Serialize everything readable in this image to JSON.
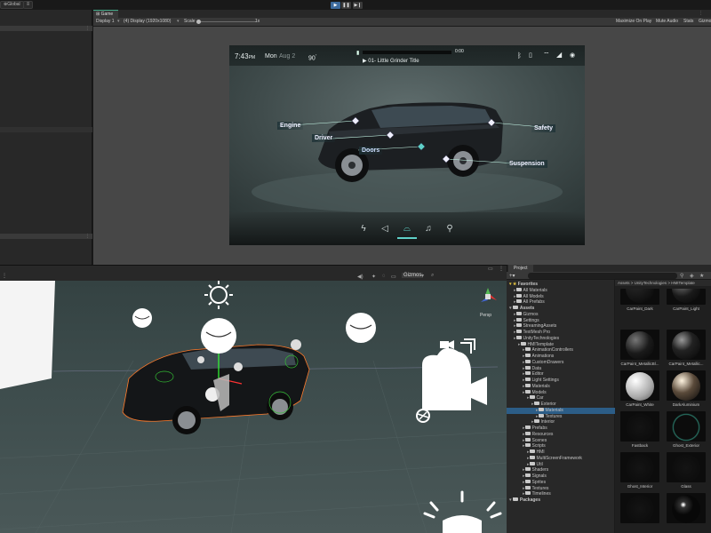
{
  "toolbar": {
    "global_label": "Global",
    "play_icon": "play-icon",
    "pause_icon": "pause-icon",
    "step_icon": "step-icon"
  },
  "game": {
    "tab_label": "Game",
    "display": "Display 1",
    "resolution": "(4) Display (1920x1080)",
    "scale_label": "Scale",
    "scale_value": "1x",
    "maximize": "Maximize On Play",
    "mute": "Mute Audio",
    "stats": "Stats",
    "gizmos": "Gizmos"
  },
  "hmi": {
    "time": "7:43",
    "time_suffix": "PM",
    "day": "Mon",
    "date": "Aug 2",
    "temp": "90",
    "track_time": "0:00",
    "track_title": "01- Little Grinder Title",
    "labels": {
      "engine": "Engine",
      "driver": "Driver",
      "doors": "Doors",
      "safety": "Safety",
      "suspension": "Suspension"
    },
    "dock_icons": [
      "bolt-icon",
      "navigation-icon",
      "car-icon",
      "music-icon",
      "user-icon"
    ]
  },
  "scene": {
    "gizmos_label": "Gizmos",
    "persp_label": "Persp"
  },
  "project": {
    "tab_label": "Project",
    "breadcrumb": "Assets > UnityTechnologies > HMITemplate",
    "favorites": "Favorites",
    "tree": [
      {
        "label": "Favorites",
        "depth": 0,
        "bold": true,
        "star": true
      },
      {
        "label": "All Materials",
        "depth": 1
      },
      {
        "label": "All Models",
        "depth": 1
      },
      {
        "label": "All Prefabs",
        "depth": 1
      },
      {
        "label": "Assets",
        "depth": 0,
        "bold": true
      },
      {
        "label": "Gizmos",
        "depth": 1
      },
      {
        "label": "Settings",
        "depth": 1
      },
      {
        "label": "StreamingAssets",
        "depth": 1
      },
      {
        "label": "TextMesh Pro",
        "depth": 1
      },
      {
        "label": "UnityTechnologies",
        "depth": 1
      },
      {
        "label": "HMITemplate",
        "depth": 2
      },
      {
        "label": "AnimationControllers",
        "depth": 3
      },
      {
        "label": "Animations",
        "depth": 3
      },
      {
        "label": "CustomDrawers",
        "depth": 3
      },
      {
        "label": "Data",
        "depth": 3
      },
      {
        "label": "Editor",
        "depth": 3
      },
      {
        "label": "Light Settings",
        "depth": 3
      },
      {
        "label": "Materials",
        "depth": 3
      },
      {
        "label": "Models",
        "depth": 3
      },
      {
        "label": "Car",
        "depth": 4
      },
      {
        "label": "Exterior",
        "depth": 5
      },
      {
        "label": "Materials",
        "depth": 6,
        "selected": true
      },
      {
        "label": "Textures",
        "depth": 6
      },
      {
        "label": "Interior",
        "depth": 5
      },
      {
        "label": "Prefabs",
        "depth": 3
      },
      {
        "label": "Resources",
        "depth": 3
      },
      {
        "label": "Scenes",
        "depth": 3
      },
      {
        "label": "Scripts",
        "depth": 3
      },
      {
        "label": "HMI",
        "depth": 4
      },
      {
        "label": "MultiScreenFramework",
        "depth": 4
      },
      {
        "label": "Util",
        "depth": 4
      },
      {
        "label": "Shaders",
        "depth": 3
      },
      {
        "label": "Signals",
        "depth": 3
      },
      {
        "label": "Sprites",
        "depth": 3
      },
      {
        "label": "Textures",
        "depth": 3
      },
      {
        "label": "Timelines",
        "depth": 3
      },
      {
        "label": "Packages",
        "depth": 0,
        "bold": true
      }
    ],
    "materials": [
      {
        "name": "CarPaint_Dark",
        "style": "dark"
      },
      {
        "name": "CarPaint_Light",
        "style": "sphere-dark"
      },
      {
        "name": "CarPaint_MetallicBl...",
        "style": "sphere-dark"
      },
      {
        "name": "CarPaint_Metallic...",
        "style": "sphere-black"
      },
      {
        "name": "CarPaint_White",
        "style": "sphere-white"
      },
      {
        "name": "DarkAluminium",
        "style": "sphere-warm"
      },
      {
        "name": "Fastback",
        "style": "flat"
      },
      {
        "name": "Ghost_Exterior",
        "style": "ring"
      },
      {
        "name": "Ghost_Interior",
        "style": "flat"
      },
      {
        "name": "Glass",
        "style": "flat"
      },
      {
        "name": "",
        "style": "flat"
      },
      {
        "name": "",
        "style": "sphere-spot"
      }
    ]
  },
  "colors": {
    "accent": "#3d6b9e",
    "hmi_teal": "#5fd0c8",
    "selection": "#2c5d87"
  }
}
